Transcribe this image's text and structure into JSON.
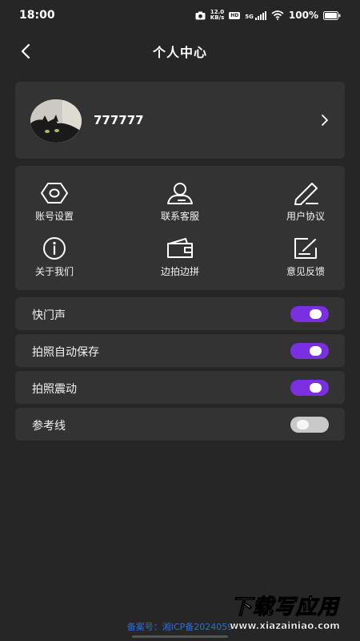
{
  "status_bar": {
    "time": "18:00",
    "speed_value": "12.0",
    "speed_unit": "KB/s",
    "hd": "HD",
    "network": "5G",
    "battery": "100%"
  },
  "nav": {
    "title": "个人中心"
  },
  "profile": {
    "username": "777777"
  },
  "menu": {
    "items": [
      {
        "label": "账号设置",
        "icon": "hexagon-settings-icon"
      },
      {
        "label": "联系客服",
        "icon": "customer-service-icon"
      },
      {
        "label": "用户协议",
        "icon": "pen-agreement-icon"
      },
      {
        "label": "关于我们",
        "icon": "info-icon"
      },
      {
        "label": "边拍边拼",
        "icon": "wallet-icon"
      },
      {
        "label": "意见反馈",
        "icon": "feedback-edit-icon"
      }
    ]
  },
  "toggles": [
    {
      "label": "快门声",
      "on": true
    },
    {
      "label": "拍照自动保存",
      "on": true
    },
    {
      "label": "拍照震动",
      "on": true
    },
    {
      "label": "参考线",
      "on": false
    }
  ],
  "footer": {
    "icp": "备案号：湘ICP备2024059"
  },
  "watermark": {
    "main": "下载写应用",
    "sub": "www.xiazainiao.com"
  },
  "colors": {
    "background": "#262626",
    "card": "#333333",
    "switch_on": "#7a2fe0",
    "switch_off": "#c9c9c9",
    "footer_link": "#2b6fd6"
  }
}
